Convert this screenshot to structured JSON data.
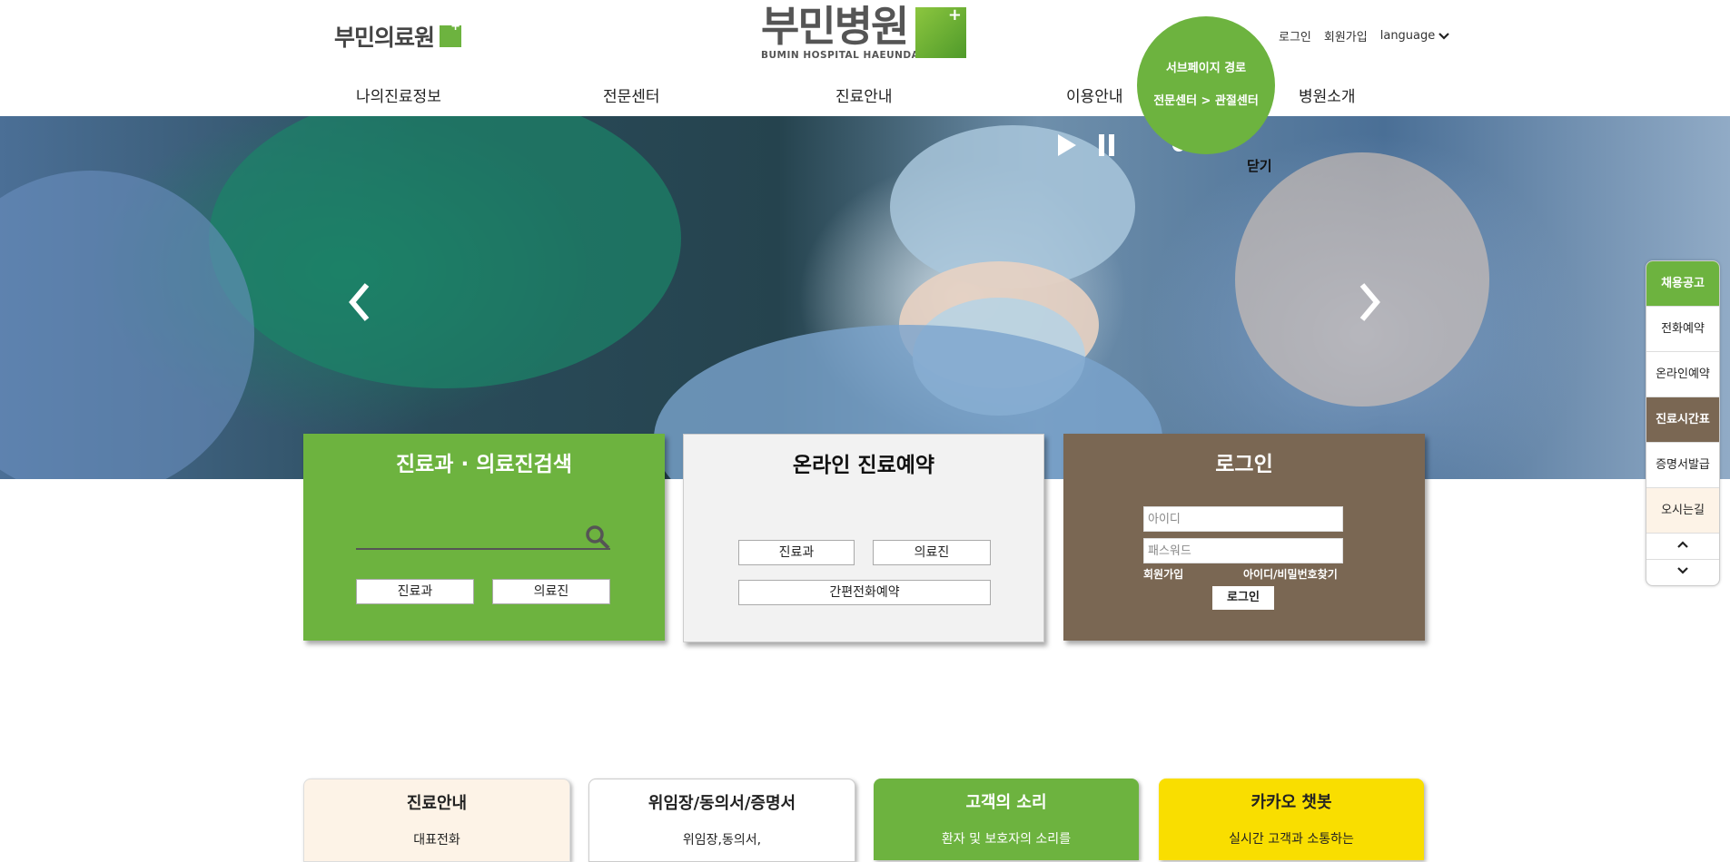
{
  "header": {
    "brand_left": "부민의료원",
    "logo_ko": "부민병원",
    "logo_en": "BUMIN HOSPITAL HAEUNDAE",
    "util": {
      "login": "로그인",
      "join": "회원가입",
      "language": "language"
    }
  },
  "gnb": [
    "나의진료정보",
    "전문센터",
    "진료안내",
    "이용안내",
    "병원소개"
  ],
  "breadcrumb": {
    "title": "서브페이지 경로",
    "path": "전문센터 > 관절센터"
  },
  "hero": {
    "close_label": "닫기"
  },
  "search_panel": {
    "title": "진료과 · 의료진검색",
    "btn_dept": "진료과",
    "btn_doctor": "의료진"
  },
  "reserve_panel": {
    "title": "온라인 진료예약",
    "btn_dept": "진료과",
    "btn_doctor": "의료진",
    "btn_phone": "간편전화예약"
  },
  "login_panel": {
    "title": "로그인",
    "id_placeholder": "아이디",
    "pw_placeholder": "패스워드",
    "join": "회원가입",
    "find": "아이디/비밀번호찾기",
    "submit": "로그인"
  },
  "quick_menu": [
    "채용공고",
    "전화예약",
    "온라인예약",
    "진료시간표",
    "증명서발급",
    "오시는길"
  ],
  "cards": [
    {
      "title": "진료안내",
      "sub": "대표전화"
    },
    {
      "title": "위임장/동의서/증명서",
      "sub": "위임장,동의서,"
    },
    {
      "title": "고객의 소리",
      "sub": "환자 및 보호자의 소리를"
    },
    {
      "title": "카카오 챗봇",
      "sub": "실시간 고객과 소통하는"
    }
  ],
  "colors": {
    "green": "#6db33f",
    "brown": "#7a6753",
    "cream": "#fdf3e7",
    "yellow": "#f9de00"
  }
}
